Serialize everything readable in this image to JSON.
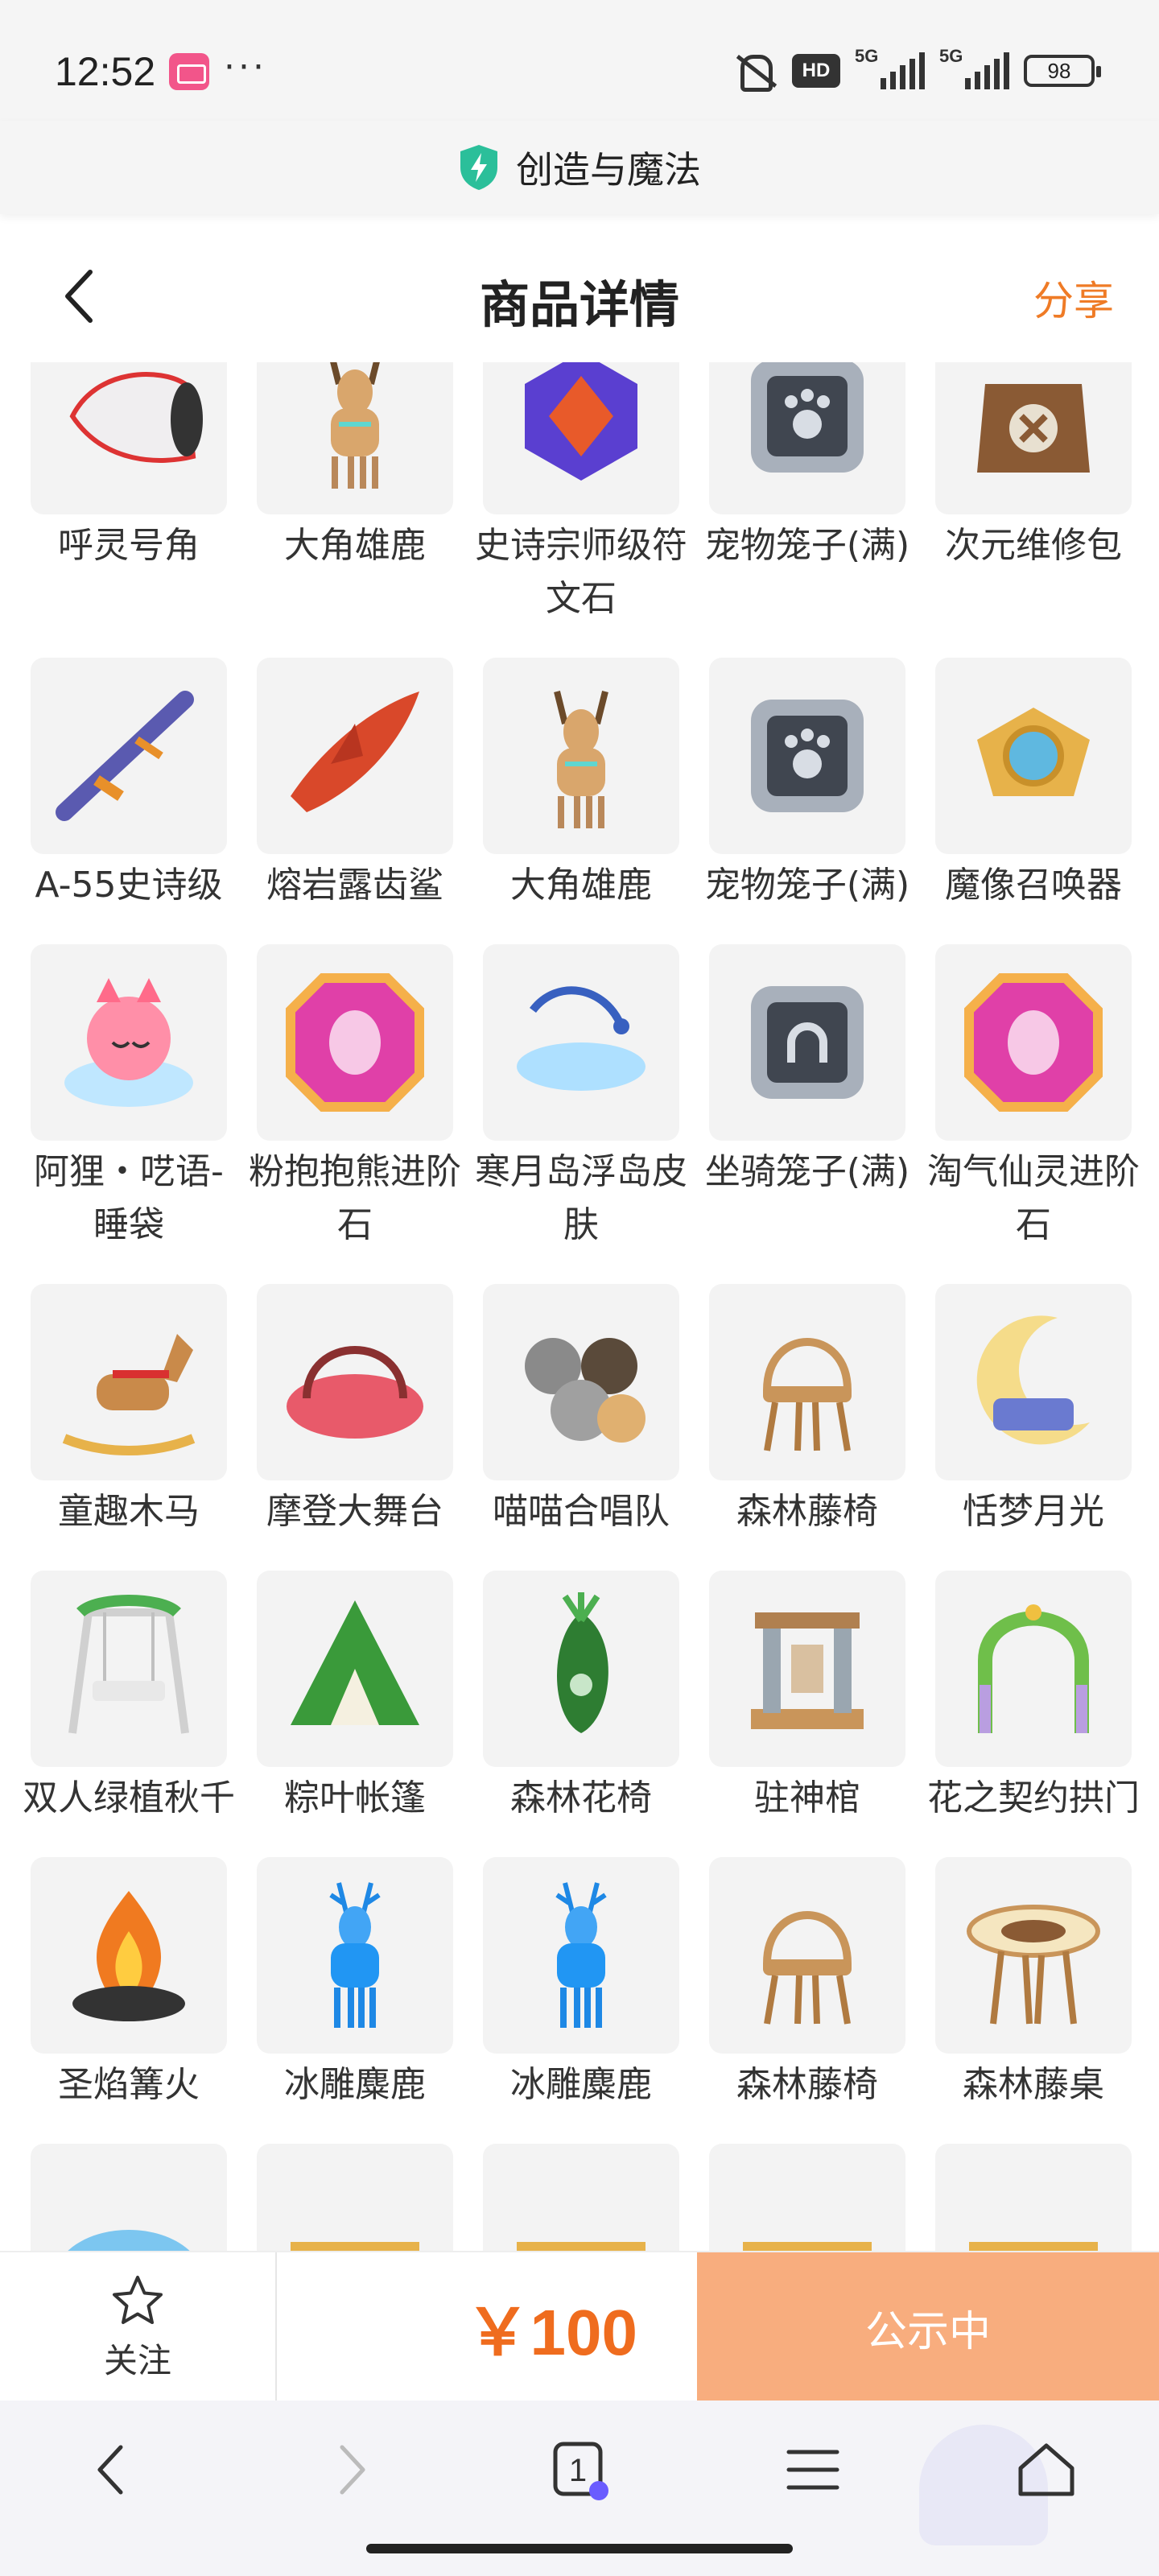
{
  "status_bar": {
    "time": "12:52",
    "dots": "···",
    "hd": "HD",
    "signal1": "5G",
    "signal2": "5G",
    "battery": "98",
    "icons": [
      "app-icon",
      "mute-icon",
      "hd-icon",
      "signal-icon",
      "battery-icon"
    ]
  },
  "app_bar": {
    "title": "创造与魔法",
    "icon": "shield-bolt-icon",
    "accent": "#2bbf9a"
  },
  "header": {
    "title": "商品详情",
    "share": "分享",
    "back_icon": "chevron-left-icon",
    "share_color": "#ef7b26"
  },
  "items": [
    {
      "name": "呼灵号角",
      "icon": "horn-icon"
    },
    {
      "name": "大角雄鹿",
      "icon": "deer-icon"
    },
    {
      "name": "史诗宗师级符文石",
      "icon": "rune-stone-icon"
    },
    {
      "name": "宠物笼子(满)",
      "icon": "pet-cage-icon"
    },
    {
      "name": "次元维修包",
      "icon": "repair-bag-icon"
    },
    {
      "name": "A-55史诗级",
      "icon": "rifle-icon"
    },
    {
      "name": "熔岩露齿鲨",
      "icon": "shark-icon"
    },
    {
      "name": "大角雄鹿",
      "icon": "deer-icon"
    },
    {
      "name": "宠物笼子(满)",
      "icon": "pet-cage-icon"
    },
    {
      "name": "魔像召唤器",
      "icon": "summoner-icon"
    },
    {
      "name": "阿狸・呓语-睡袋",
      "icon": "sleeping-bag-icon"
    },
    {
      "name": "粉抱抱熊进阶石",
      "icon": "gem-icon"
    },
    {
      "name": "寒月岛浮岛皮肤",
      "icon": "floating-island-icon"
    },
    {
      "name": "坐骑笼子(满)",
      "icon": "mount-cage-icon"
    },
    {
      "name": "淘气仙灵进阶石",
      "icon": "gem-icon"
    },
    {
      "name": "童趣木马",
      "icon": "rocking-horse-icon"
    },
    {
      "name": "摩登大舞台",
      "icon": "stage-icon"
    },
    {
      "name": "喵喵合唱队",
      "icon": "cats-icon"
    },
    {
      "name": "森林藤椅",
      "icon": "rattan-chair-icon"
    },
    {
      "name": "恬梦月光",
      "icon": "moon-icon"
    },
    {
      "name": "双人绿植秋千",
      "icon": "swing-icon"
    },
    {
      "name": "粽叶帐篷",
      "icon": "tent-icon"
    },
    {
      "name": "森林花椅",
      "icon": "flower-chair-icon"
    },
    {
      "name": "驻神棺",
      "icon": "shrine-icon"
    },
    {
      "name": "花之契约拱门",
      "icon": "arch-icon"
    },
    {
      "name": "圣焰篝火",
      "icon": "campfire-icon"
    },
    {
      "name": "冰雕麋鹿",
      "icon": "ice-deer-icon"
    },
    {
      "name": "冰雕麋鹿",
      "icon": "ice-deer-icon"
    },
    {
      "name": "森林藤椅",
      "icon": "rattan-chair-icon"
    },
    {
      "name": "森林藤桌",
      "icon": "rattan-table-icon"
    },
    {
      "name": "",
      "icon": "umbrella-icon"
    },
    {
      "name": "",
      "icon": "curtain-stage-icon"
    },
    {
      "name": "",
      "icon": "curtain-stage-icon"
    },
    {
      "name": "",
      "icon": "curtain-stage-icon"
    },
    {
      "name": "",
      "icon": "curtain-stage-icon"
    }
  ],
  "action_bar": {
    "follow": "关注",
    "price": "￥100",
    "status": "公示中",
    "price_color": "#ef6c1e",
    "status_bg": "#f8ad7e"
  },
  "browser_bar": {
    "tab_count": "1"
  }
}
